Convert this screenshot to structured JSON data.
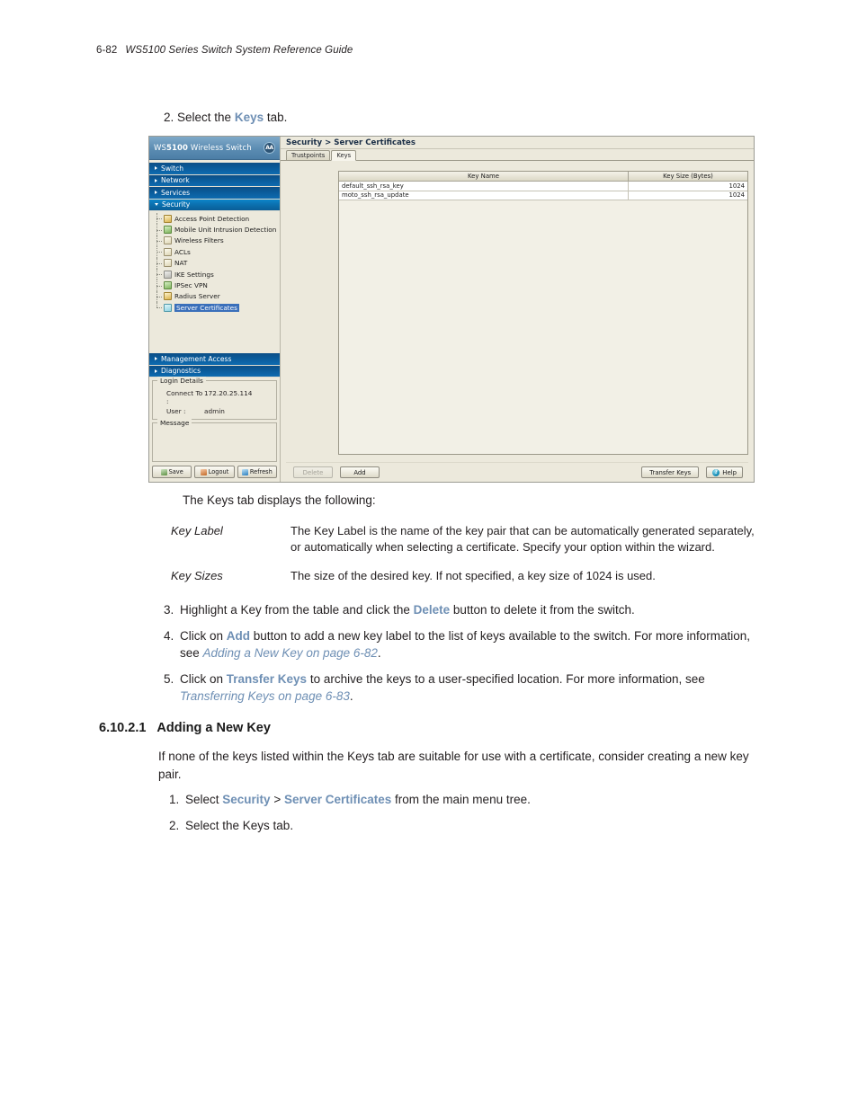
{
  "page": {
    "folio": "6-82",
    "guide_title": "WS5100 Series Switch System Reference Guide"
  },
  "step_top": {
    "number": "2.",
    "text_before": "Select the ",
    "highlight": "Keys",
    "text_after": " tab."
  },
  "screenshot": {
    "brand": {
      "name_prefix": "WS",
      "name_bold": "5100",
      "name_suffix": " Wireless Switch",
      "logo_text": "AA"
    },
    "nav_groups": [
      {
        "label": "Switch",
        "expanded": false
      },
      {
        "label": "Network",
        "expanded": false
      },
      {
        "label": "Services",
        "expanded": false
      },
      {
        "label": "Security",
        "expanded": true
      }
    ],
    "tree_items": [
      {
        "label": "Access Point Detection",
        "icon": "gold",
        "selected": false
      },
      {
        "label": "Mobile Unit Intrusion Detection",
        "icon": "green",
        "selected": false
      },
      {
        "label": "Wireless Filters",
        "icon": "paper",
        "selected": false
      },
      {
        "label": "ACLs",
        "icon": "paper",
        "selected": false
      },
      {
        "label": "NAT",
        "icon": "paper",
        "selected": false
      },
      {
        "label": "IKE Settings",
        "icon": "gray",
        "selected": false
      },
      {
        "label": "IPSec VPN",
        "icon": "green",
        "selected": false
      },
      {
        "label": "Radius Server",
        "icon": "gold",
        "selected": false
      },
      {
        "label": "Server Certificates",
        "icon": "cyan",
        "selected": true
      }
    ],
    "nav_groups_bottom": [
      {
        "label": "Management Access"
      },
      {
        "label": "Diagnostics"
      }
    ],
    "login_details": {
      "title": "Login Details",
      "connect_to_label": "Connect To :",
      "connect_to_value": "172.20.25.114",
      "user_label": "User :",
      "user_value": "admin"
    },
    "message_panel": {
      "title": "Message",
      "value": ""
    },
    "nav_buttons": [
      {
        "label": "Save",
        "icon": "save-icon"
      },
      {
        "label": "Logout",
        "icon": "logout-icon"
      },
      {
        "label": "Refresh",
        "icon": "refresh-icon"
      }
    ],
    "breadcrumb": "Security > Server Certificates",
    "tabs": [
      {
        "label": "Trustpoints",
        "active": false
      },
      {
        "label": "Keys",
        "active": true
      }
    ],
    "table": {
      "columns": [
        "Key Name",
        "Key Size (Bytes)"
      ],
      "rows": [
        [
          "default_ssh_rsa_key",
          "1024"
        ],
        [
          "moto_ssh_rsa_update",
          "1024"
        ]
      ]
    },
    "action_buttons": {
      "delete": "Delete",
      "add": "Add",
      "transfer_keys": "Transfer Keys",
      "help": "Help",
      "help_glyph": "?"
    }
  },
  "intro_line": "The Keys tab displays the following:",
  "definitions": [
    {
      "term": "Key Label",
      "body": "The Key Label is the name of the key pair that can be automatically generated separately, or automatically when selecting a certificate. Specify your option within the wizard."
    },
    {
      "term": "Key Sizes",
      "body": "The size of the desired key. If not specified, a key size of 1024 is used."
    }
  ],
  "steps": [
    {
      "number": "3.",
      "parts": [
        {
          "t": "Highlight a Key from the table and click the ",
          "style": "plain"
        },
        {
          "t": "Delete",
          "style": "hl"
        },
        {
          "t": " button to delete it from the switch.",
          "style": "plain"
        }
      ]
    },
    {
      "number": "4.",
      "parts": [
        {
          "t": "Click on ",
          "style": "plain"
        },
        {
          "t": "Add",
          "style": "hl"
        },
        {
          "t": " button to add a new key label to the list of keys available to the switch. For more information, see ",
          "style": "plain"
        },
        {
          "t": "Adding a New Key on page 6-82",
          "style": "xref"
        },
        {
          "t": ".",
          "style": "plain"
        }
      ]
    },
    {
      "number": "5.",
      "parts": [
        {
          "t": "Click on ",
          "style": "plain"
        },
        {
          "t": "Transfer Keys",
          "style": "hl"
        },
        {
          "t": " to archive the keys to a user-specified location. For more information, see ",
          "style": "plain"
        },
        {
          "t": "Transferring Keys on page 6-83",
          "style": "xref"
        },
        {
          "t": ".",
          "style": "plain"
        }
      ]
    }
  ],
  "section": {
    "number": "6.10.2.1",
    "title": "Adding a New Key",
    "paragraph": "If none of the keys listed within the Keys tab are suitable for use with a certificate, consider creating a new key pair."
  },
  "steps2": [
    {
      "number": "1.",
      "parts": [
        {
          "t": "Select ",
          "style": "plain"
        },
        {
          "t": "Security",
          "style": "hl"
        },
        {
          "t": " > ",
          "style": "plain"
        },
        {
          "t": "Server Certificates",
          "style": "hl"
        },
        {
          "t": " from the main menu tree.",
          "style": "plain"
        }
      ]
    },
    {
      "number": "2.",
      "parts": [
        {
          "t": "Select the Keys tab.",
          "style": "plain"
        }
      ]
    }
  ]
}
